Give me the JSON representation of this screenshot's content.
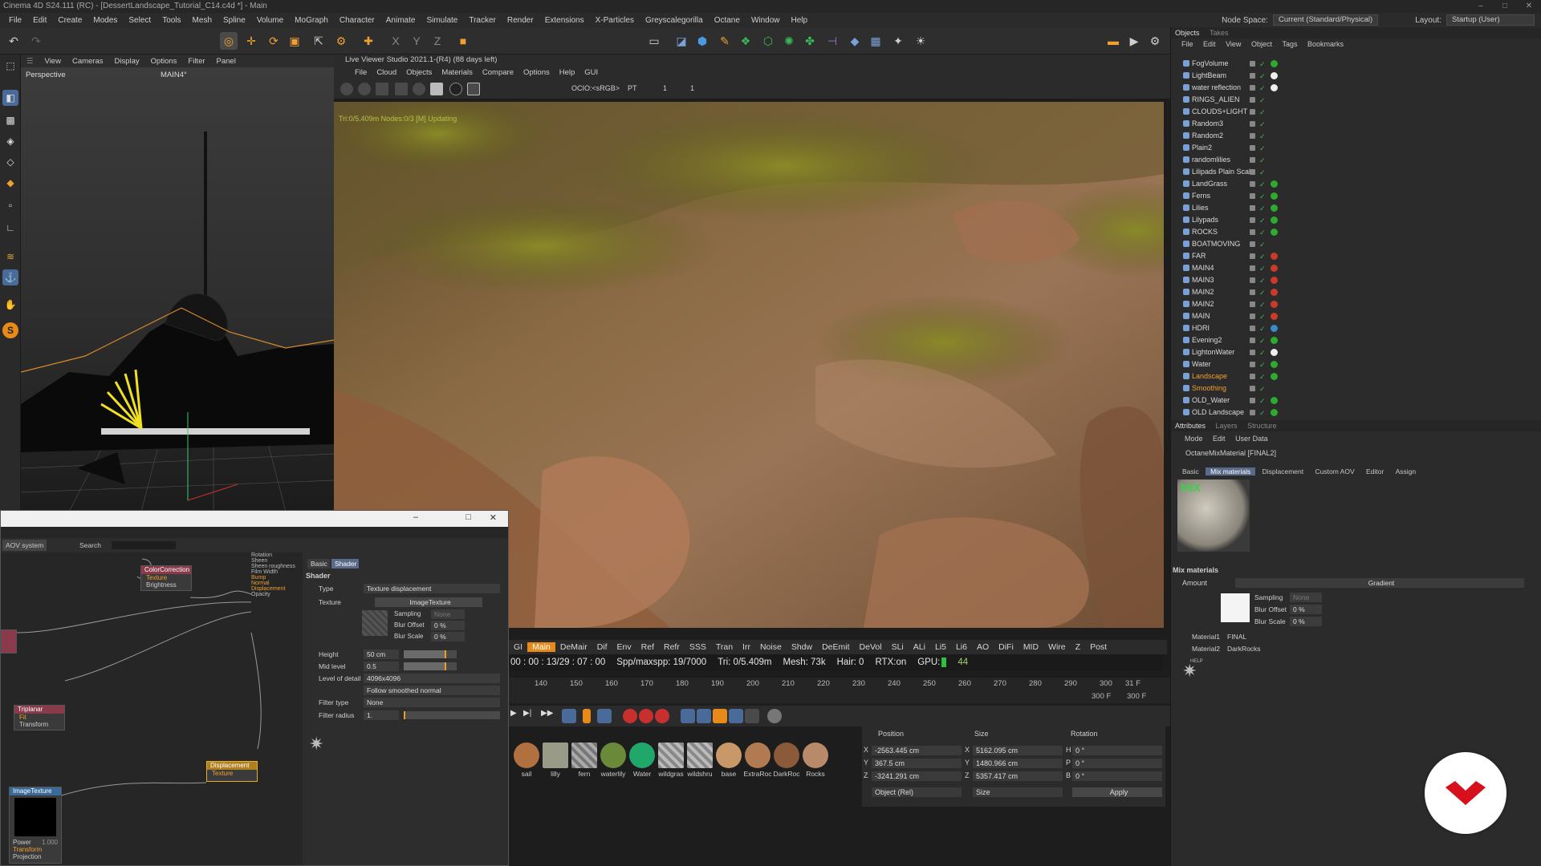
{
  "window": {
    "title": "Cinema 4D S24.111 (RC) - [DessertLandscape_Tutorial_C14.c4d *] - Main"
  },
  "menubar": {
    "items": [
      "File",
      "Edit",
      "Create",
      "Modes",
      "Select",
      "Tools",
      "Mesh",
      "Spline",
      "Volume",
      "MoGraph",
      "Character",
      "Animate",
      "Simulate",
      "Tracker",
      "Render",
      "Extensions",
      "X-Particles",
      "Greyscalegorilla",
      "Octane",
      "Window",
      "Help"
    ],
    "node_space_label": "Node Space:",
    "node_space_value": "Current (Standard/Physical)",
    "layout_label": "Layout:",
    "layout_value": "Startup (User)"
  },
  "viewport": {
    "menu": [
      "View",
      "Cameras",
      "Display",
      "Options",
      "Filter",
      "Panel"
    ],
    "label": "Perspective",
    "camera": "MAIN4°"
  },
  "liveviewer": {
    "title": "Live Viewer Studio 2021.1-(R4) (88 days left)",
    "menu": [
      "File",
      "Cloud",
      "Objects",
      "Materials",
      "Compare",
      "Options",
      "Help",
      "GUI"
    ],
    "ocio": "OCIO:<sRGB>",
    "pt": "PT",
    "num1": "1",
    "num2": "1",
    "render_note": "Tri:0/5.409m  Nodes:0/3  [M] Updating",
    "tabs": [
      "GI",
      "Main",
      "DeMair",
      "Dif",
      "Env",
      "Ref",
      "Refr",
      "SSS",
      "Tran",
      "Irr",
      "Noise",
      "Shdw",
      "DeEmit",
      "DeVol",
      "SLi",
      "ALi",
      "Li5",
      "Li6",
      "AO",
      "DiFi",
      "MID",
      "Wire",
      "Z",
      "Post"
    ],
    "active_tab": "Main",
    "status": {
      "time": "00 : 00 : 13/29 : 07 : 00",
      "spp": "Spp/maxspp: 19/7000",
      "tri": "Tri: 0/5.409m",
      "mesh": "Mesh: 73k",
      "hair": "Hair: 0",
      "rtx": "RTX:on",
      "gpu": "GPU:",
      "gpu_value": "44"
    }
  },
  "timeline": {
    "ticks": [
      "140",
      "150",
      "160",
      "170",
      "180",
      "190",
      "200",
      "210",
      "220",
      "230",
      "240",
      "250",
      "260",
      "270",
      "280",
      "290",
      "300"
    ],
    "current_frame": "31 F",
    "end_frame_a": "300 F",
    "end_frame_b": "300 F"
  },
  "materials": [
    {
      "name": "sail",
      "color": "#b07040"
    },
    {
      "name": "lilly",
      "color": "#9a9a88"
    },
    {
      "name": "fern",
      "color": "#8a8a8a"
    },
    {
      "name": "waterlily",
      "color": "#6a8a3a"
    },
    {
      "name": "Water",
      "color": "#1fa86a"
    },
    {
      "name": "wildgras",
      "color": "#9a9a9a"
    },
    {
      "name": "wildshru",
      "color": "#9a9a9a"
    },
    {
      "name": "base",
      "color": "#c89868"
    },
    {
      "name": "ExtraRoc",
      "color": "#b07a52"
    },
    {
      "name": "DarkRoc",
      "color": "#8a5a3a"
    },
    {
      "name": "Rocks",
      "color": "#b88a6a"
    }
  ],
  "coordinates": {
    "headers": [
      "Position",
      "Size",
      "Rotation"
    ],
    "x": {
      "pos": "-2563.445 cm",
      "size": "5162.095 cm",
      "rot": "0 °"
    },
    "y": {
      "pos": "367.5 cm",
      "size": "1480.966 cm",
      "rot": "0 °"
    },
    "z": {
      "pos": "-3241.291 cm",
      "size": "5357.417 cm",
      "rot": "0 °"
    },
    "axis_labels": [
      "X",
      "Y",
      "Z",
      "X",
      "Y",
      "Z",
      "H",
      "P",
      "B"
    ],
    "mode": "Object (Rel)",
    "size_mode": "Size",
    "apply": "Apply"
  },
  "objects_panel": {
    "tabs": [
      "Objects",
      "Takes"
    ],
    "menu": [
      "File",
      "Edit",
      "View",
      "Object",
      "Tags",
      "Bookmarks"
    ],
    "rows": [
      {
        "name": "FogVolume",
        "tag": "#2eaa2e"
      },
      {
        "name": "LightBeam",
        "tag": "#eeeeee"
      },
      {
        "name": "water reflection",
        "tag": "#eeeeee"
      },
      {
        "name": "RINGS_ALIEN",
        "tag": ""
      },
      {
        "name": "CLOUDS+LIGHT",
        "tag": ""
      },
      {
        "name": "Random3",
        "tag": ""
      },
      {
        "name": "Random2",
        "tag": ""
      },
      {
        "name": "Plain2",
        "tag": ""
      },
      {
        "name": "randomlilies",
        "tag": ""
      },
      {
        "name": "Lilipads Plain Scale",
        "tag": ""
      },
      {
        "name": "LandGrass",
        "tag": "#2eaa2e"
      },
      {
        "name": "Ferns",
        "tag": "#2eaa2e"
      },
      {
        "name": "Lilies",
        "tag": "#2eaa2e"
      },
      {
        "name": "Lilypads",
        "tag": "#2eaa2e"
      },
      {
        "name": "ROCKS",
        "tag": "#2eaa2e"
      },
      {
        "name": "BOATMOVING",
        "tag": ""
      },
      {
        "name": "FAR",
        "tag": "#cc3a2a"
      },
      {
        "name": "MAIN4",
        "tag": "#cc3a2a"
      },
      {
        "name": "MAIN3",
        "tag": "#cc3a2a"
      },
      {
        "name": "MAIN2",
        "tag": "#cc3a2a"
      },
      {
        "name": "MAIN2",
        "tag": "#cc3a2a"
      },
      {
        "name": "MAIN",
        "tag": "#cc3a2a"
      },
      {
        "name": "HDRI",
        "tag": "#3a8acc"
      },
      {
        "name": "Evening2",
        "tag": "#2eaa2e"
      },
      {
        "name": "LightonWater",
        "tag": "#eeeeee"
      },
      {
        "name": "Water",
        "tag": "#2eaa2e"
      },
      {
        "name": "Landscape",
        "tag": "#2eaa2e",
        "orange": true
      },
      {
        "name": "Smoothing",
        "tag": "",
        "orange": true
      },
      {
        "name": "OLD_Water",
        "tag": "#2eaa2e"
      },
      {
        "name": "OLD Landscape",
        "tag": "#2eaa2e"
      }
    ]
  },
  "attributes": {
    "tabs": [
      "Attributes",
      "Layers",
      "Structure"
    ],
    "menu": [
      "Mode",
      "Edit",
      "User Data"
    ],
    "material_name": "OctaneMixMaterial [FINAL2]",
    "subtabs": [
      "Basic",
      "Mix materials",
      "Displacement",
      "Custom AOV",
      "Editor",
      "Assign"
    ],
    "active_subtab": "Mix materials",
    "thumb_label": "MIX",
    "section": "Mix materials",
    "amount_label": "Amount",
    "amount_value": "Gradient",
    "sampling_label": "Sampling",
    "sampling_value": "None",
    "blur_offset_label": "Blur Offset",
    "blur_offset_value": "0 %",
    "blur_scale_label": "Blur Scale",
    "blur_scale_value": "0 %",
    "material1_label": "Material1",
    "material1_value": "FINAL",
    "material2_label": "Material2",
    "material2_value": "DarkRocks",
    "help": "HELP"
  },
  "node_editor": {
    "tabs": [
      "AOV system"
    ],
    "search": "Search",
    "nodes": {
      "colorcorrection": {
        "title": "ColorCorrection",
        "ports": [
          "Texture",
          "Brightness"
        ]
      },
      "triplanar": {
        "title": "Triplanar",
        "ports": [
          "Fit",
          "Transform"
        ]
      },
      "imagetexture": {
        "title": "ImageTexture",
        "ports": [
          "Power",
          "Transform",
          "Projection"
        ],
        "power_value": "1.000"
      },
      "displacement": {
        "title": "Displacement",
        "ports": [
          "Texture"
        ]
      },
      "material_ports": [
        "Rotation",
        "Sheen",
        "Sheen roughness",
        "Film Width",
        "Bump",
        "Normal",
        "Displacement",
        "Opacity"
      ]
    },
    "inspector": {
      "tabs": [
        "Basic",
        "Shader"
      ],
      "active_tab": "Shader",
      "section": "Shader",
      "type_label": "Type",
      "type_value": "Texture displacement",
      "texture_label": "Texture",
      "texture_value": "ImageTexture",
      "sampling_label": "Sampling",
      "sampling_value": "None",
      "blur_offset_label": "Blur Offset",
      "blur_offset_value": "0 %",
      "blur_scale_label": "Blur Scale",
      "blur_scale_value": "0 %",
      "height_label": "Height",
      "height_value": "50 cm",
      "midlevel_label": "Mid level",
      "midlevel_value": "0.5",
      "lod_label": "Level of detail",
      "lod_value": "4096x4096",
      "lod2_value": "Follow smoothed normal",
      "filter_type_label": "Filter type",
      "filter_type_value": "None",
      "filter_radius_label": "Filter radius",
      "filter_radius_value": "1."
    }
  },
  "colors": {
    "accent": "#e88a1a",
    "brand_logo": "#d6111b"
  }
}
